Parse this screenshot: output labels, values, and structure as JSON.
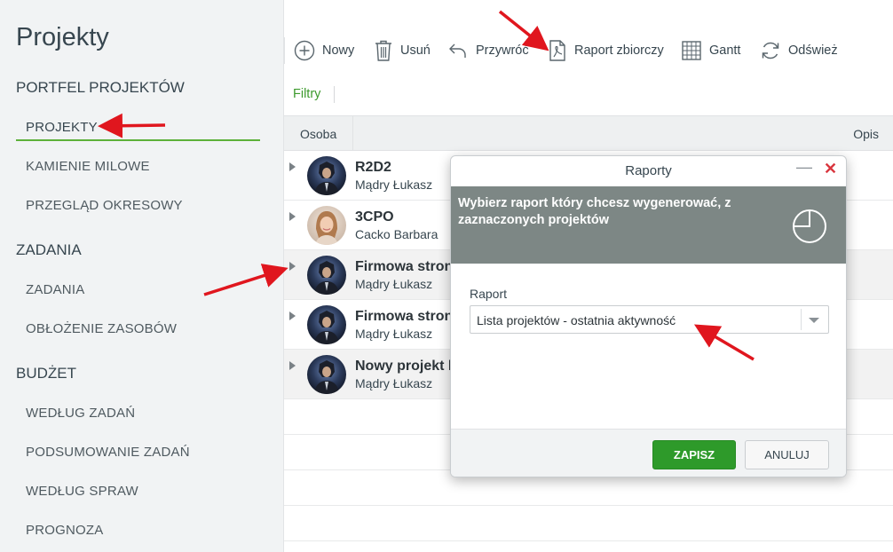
{
  "sidebar": {
    "title": "Projekty",
    "sections": [
      {
        "label": "PORTFEL PROJEKTÓW",
        "items": [
          "PROJEKTY",
          "KAMIENIE MILOWE",
          "PRZEGLĄD OKRESOWY"
        ]
      },
      {
        "label": "ZADANIA",
        "items": [
          "ZADANIA",
          "OBŁOŻENIE ZASOBÓW"
        ]
      },
      {
        "label": "BUDŻET",
        "items": [
          "WEDŁUG ZADAŃ",
          "PODSUMOWANIE ZADAŃ",
          "WEDŁUG SPRAW",
          "PROGNOZA"
        ]
      }
    ],
    "active_item": "PROJEKTY"
  },
  "toolbar": {
    "new": "Nowy",
    "delete": "Usuń",
    "restore": "Przywróć",
    "summary_report": "Raport zbiorczy",
    "gantt": "Gantt",
    "refresh": "Odśwież"
  },
  "filters_label": "Filtry",
  "grid": {
    "columns": [
      "Osoba",
      "Opis"
    ],
    "rows": [
      {
        "name": "R2D2",
        "owner": "Mądry Łukasz",
        "avatar": "avatar-dark",
        "highlight": false
      },
      {
        "name": "3CPO",
        "owner": "Cacko Barbara",
        "avatar": "avatar-woman",
        "highlight": false
      },
      {
        "name": "Firmowa stron",
        "owner": "Mądry Łukasz",
        "avatar": "avatar-dark",
        "highlight": true
      },
      {
        "name": "Firmowa stron",
        "owner": "Mądry Łukasz",
        "avatar": "avatar-dark",
        "highlight": false
      },
      {
        "name": "Nowy projekt k",
        "owner": "Mądry Łukasz",
        "avatar": "avatar-dark",
        "highlight": true
      }
    ]
  },
  "dialog": {
    "title": "Raporty",
    "banner": "Wybierz raport który chcesz wygenerować, z zaznaczonych projektów",
    "field_label": "Raport",
    "selected_report": "Lista projektów - ostatnia aktywność",
    "save": "ZAPISZ",
    "cancel": "ANULUJ"
  },
  "colors": {
    "accent_green": "#5db13a",
    "save_green": "#2e9a2a",
    "banner_gray": "#7d8785",
    "close_red": "#d9363e",
    "annotation_red": "#e0161e"
  }
}
